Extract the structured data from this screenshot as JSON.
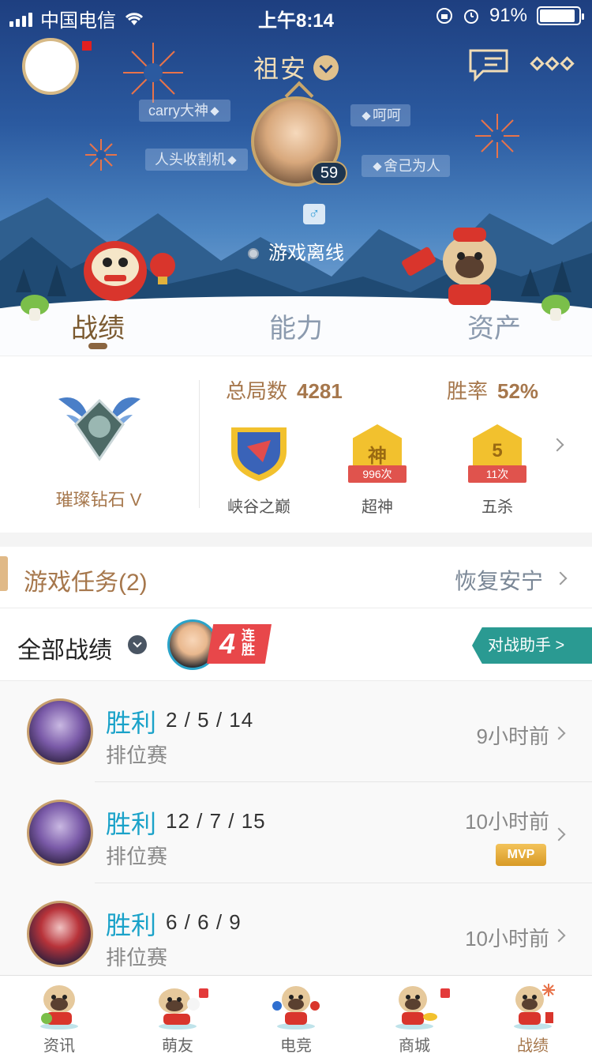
{
  "status_bar": {
    "carrier": "中国电信",
    "time": "上午8:14",
    "battery": "91%",
    "battery_level": 0.91
  },
  "profile": {
    "name": "祖安",
    "level": "59",
    "gender_icon": "male-icon",
    "tags": [
      "carry大神",
      "呵呵",
      "人头收割机",
      "舍己为人"
    ],
    "status": "游戏离线"
  },
  "tabs": [
    "战绩",
    "能力",
    "资产"
  ],
  "active_tab": 0,
  "stats": {
    "rank": "璀璨钻石 V",
    "total_games_label": "总局数",
    "total_games": "4281",
    "win_rate_label": "胜率",
    "win_rate": "52%",
    "badges": [
      {
        "label": "峡谷之巅",
        "icon": "shield-badge-icon"
      },
      {
        "label": "超神",
        "icon": "god-badge-icon",
        "glyph": "神",
        "count": "996次"
      },
      {
        "label": "五杀",
        "icon": "penta-badge-icon",
        "glyph": "5",
        "count": "11次"
      }
    ]
  },
  "task": {
    "title": "游戏任务(2)",
    "right": "恢复安宁"
  },
  "records": {
    "title": "全部战绩",
    "streak_number": "4",
    "streak_text": "连胜",
    "assistant": "对战助手 >"
  },
  "matches": [
    {
      "result": "胜利",
      "kda": "2 / 5 / 14",
      "mode": "排位赛",
      "time": "9小时前",
      "mvp": false
    },
    {
      "result": "胜利",
      "kda": "12 / 7 / 15",
      "mode": "排位赛",
      "time": "10小时前",
      "mvp": true,
      "mvp_label": "MVP"
    },
    {
      "result": "胜利",
      "kda": "6 / 6 / 9",
      "mode": "排位赛",
      "time": "10小时前",
      "mvp": false
    }
  ],
  "nav": [
    "资讯",
    "萌友",
    "电竞",
    "商城",
    "战绩"
  ],
  "active_nav": 4,
  "colors": {
    "accent_gold": "#a6774c",
    "win_blue": "#1aa2c9",
    "assistant_teal": "#2a9a92",
    "header_blue": "#2b5aa0"
  }
}
